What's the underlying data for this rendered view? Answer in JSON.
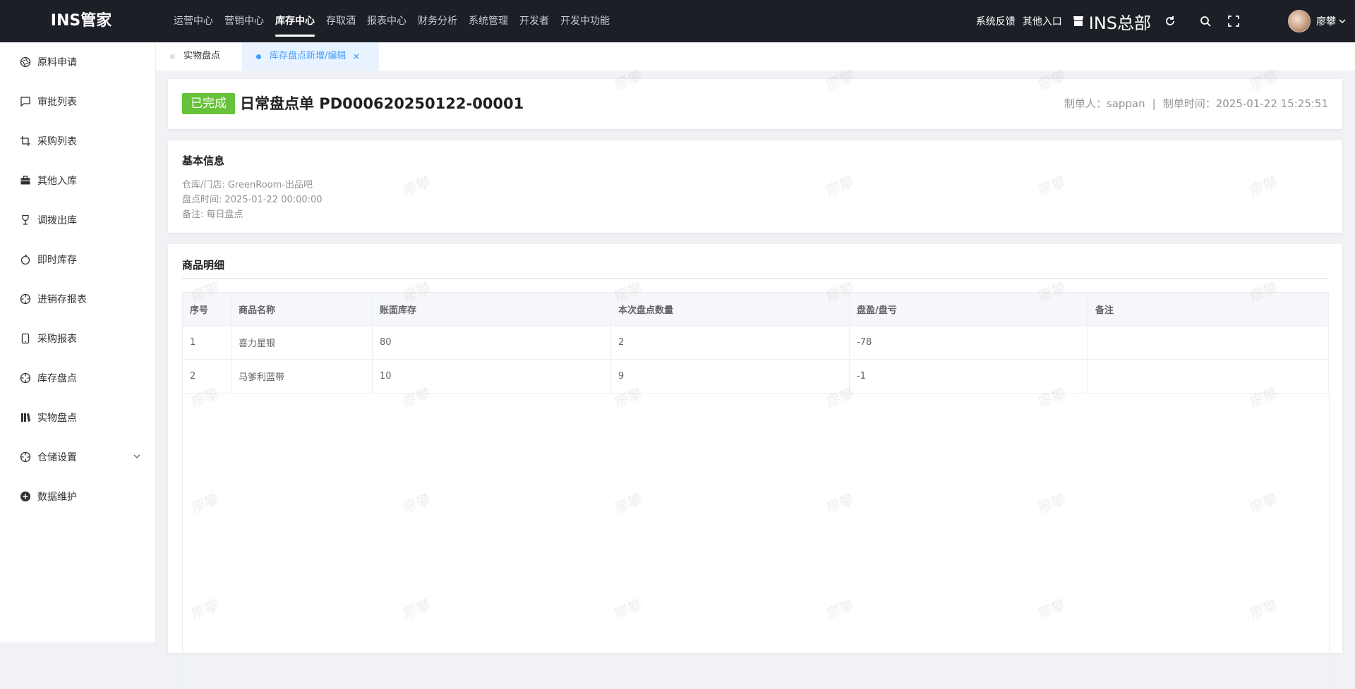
{
  "app": {
    "title": "INS管家"
  },
  "topnav": [
    {
      "label": "运营中心",
      "active": false
    },
    {
      "label": "营销中心",
      "active": false
    },
    {
      "label": "库存中心",
      "active": true
    },
    {
      "label": "存取酒",
      "active": false
    },
    {
      "label": "报表中心",
      "active": false
    },
    {
      "label": "财务分析",
      "active": false
    },
    {
      "label": "系统管理",
      "active": false
    },
    {
      "label": "开发者",
      "active": false
    },
    {
      "label": "开发中功能",
      "active": false
    }
  ],
  "header_right": {
    "feedback": "系统反馈",
    "other_entry": "其他入口",
    "store": "INS总部",
    "username": "廖攀"
  },
  "sidebar": {
    "items": [
      {
        "label": "原料申请",
        "icon": "aperture-icon"
      },
      {
        "label": "审批列表",
        "icon": "chat-icon"
      },
      {
        "label": "采购列表",
        "icon": "crop-icon"
      },
      {
        "label": "其他入库",
        "icon": "briefcase-icon"
      },
      {
        "label": "调拨出库",
        "icon": "goblet-icon"
      },
      {
        "label": "即时库存",
        "icon": "apple-icon"
      },
      {
        "label": "进销存报表",
        "icon": "crosshair-icon"
      },
      {
        "label": "采购报表",
        "icon": "mobile-icon"
      },
      {
        "label": "库存盘点",
        "icon": "crosshair-icon"
      },
      {
        "label": "实物盘点",
        "icon": "books-icon"
      },
      {
        "label": "仓储设置",
        "icon": "crosshair-icon"
      },
      {
        "label": "数据维护",
        "icon": "plus-circle-icon"
      }
    ]
  },
  "tabs": [
    {
      "label": "实物盘点",
      "active": false
    },
    {
      "label": "库存盘点新增/编辑",
      "active": true
    }
  ],
  "order": {
    "status": "已完成",
    "title": "日常盘点单 PD000620250122-00001",
    "creator": "制单人：sappan",
    "created_time": "制单时间：2025-01-22 15:25:51"
  },
  "basic_info": {
    "title": "基本信息",
    "warehouse": "仓库/门店: GreenRoom-出品吧",
    "count_time": "盘点时间: 2025-01-22 00:00:00",
    "remark": "备注: 每日盘点"
  },
  "details": {
    "title": "商品明细",
    "columns": [
      "序号",
      "商品名称",
      "账面库存",
      "本次盘点数量",
      "盘盈/盘亏",
      "备注"
    ],
    "rows": [
      [
        "1",
        "喜力星银",
        "80",
        "2",
        "-78",
        ""
      ],
      [
        "2",
        "马爹利蓝带",
        "10",
        "9",
        "-1",
        ""
      ]
    ]
  },
  "watermark": "廖攀",
  "colors": {
    "topbar": "#1c1f26",
    "status_green": "#67c23a",
    "tab_active_blue": "#409eff"
  }
}
